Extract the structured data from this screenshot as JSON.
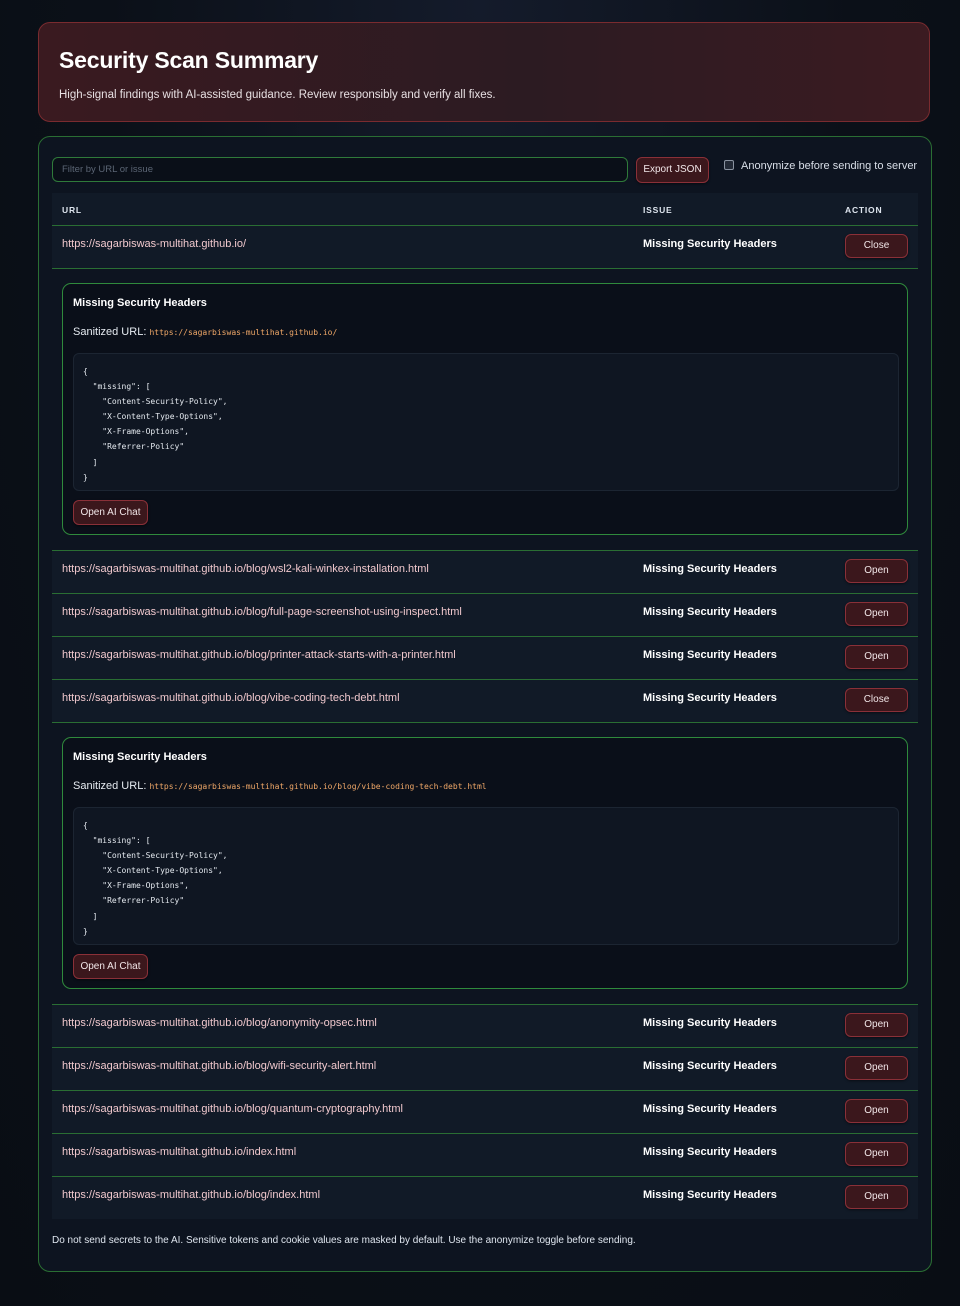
{
  "header": {
    "title": "Security Scan Summary",
    "subtitle": "High-signal findings with AI-assisted guidance. Review responsibly and verify all fixes."
  },
  "toolbar": {
    "filter_placeholder": "Filter by URL or issue",
    "export_label": "Export JSON",
    "anonymize_label": "Anonymize before sending to server",
    "anonymize_checked": false
  },
  "table": {
    "headers": {
      "url": "URL",
      "issue": "ISSUE",
      "action": "ACTION"
    },
    "rows": [
      {
        "url": "https://sagarbiswas-multihat.github.io/",
        "issue": "Missing Security Headers",
        "action": "Close"
      },
      {
        "url": "https://sagarbiswas-multihat.github.io/blog/wsl2-kali-winkex-installation.html",
        "issue": "Missing Security Headers",
        "action": "Open"
      },
      {
        "url": "https://sagarbiswas-multihat.github.io/blog/full-page-screenshot-using-inspect.html",
        "issue": "Missing Security Headers",
        "action": "Open"
      },
      {
        "url": "https://sagarbiswas-multihat.github.io/blog/printer-attack-starts-with-a-printer.html",
        "issue": "Missing Security Headers",
        "action": "Open"
      },
      {
        "url": "https://sagarbiswas-multihat.github.io/blog/vibe-coding-tech-debt.html",
        "issue": "Missing Security Headers",
        "action": "Close"
      },
      {
        "url": "https://sagarbiswas-multihat.github.io/blog/anonymity-opsec.html",
        "issue": "Missing Security Headers",
        "action": "Open"
      },
      {
        "url": "https://sagarbiswas-multihat.github.io/blog/wifi-security-alert.html",
        "issue": "Missing Security Headers",
        "action": "Open"
      },
      {
        "url": "https://sagarbiswas-multihat.github.io/blog/quantum-cryptography.html",
        "issue": "Missing Security Headers",
        "action": "Open"
      },
      {
        "url": "https://sagarbiswas-multihat.github.io/index.html",
        "issue": "Missing Security Headers",
        "action": "Open"
      },
      {
        "url": "https://sagarbiswas-multihat.github.io/blog/index.html",
        "issue": "Missing Security Headers",
        "action": "Open"
      }
    ],
    "details": [
      {
        "title": "Missing Security Headers",
        "sanitized_label": "Sanitized URL:",
        "sanitized_url": "https://sagarbiswas-multihat.github.io/",
        "json": "{\n  \"missing\": [\n    \"Content-Security-Policy\",\n    \"X-Content-Type-Options\",\n    \"X-Frame-Options\",\n    \"Referrer-Policy\"\n  ]\n}",
        "button": "Open AI Chat"
      },
      {
        "title": "Missing Security Headers",
        "sanitized_label": "Sanitized URL:",
        "sanitized_url": "https://sagarbiswas-multihat.github.io/blog/vibe-coding-tech-debt.html",
        "json": "{\n  \"missing\": [\n    \"Content-Security-Policy\",\n    \"X-Content-Type-Options\",\n    \"X-Frame-Options\",\n    \"Referrer-Policy\"\n  ]\n}",
        "button": "Open AI Chat"
      }
    ]
  },
  "footer": {
    "note": "Do not send secrets to the AI. Sensitive tokens and cookie values are masked by default. Use the anonymize toggle before sending."
  },
  "colors": {
    "accent_green": "#2a6e33",
    "accent_red": "#8a3038",
    "url_pink": "#f0c8cd",
    "code_orange": "#f0a868"
  }
}
